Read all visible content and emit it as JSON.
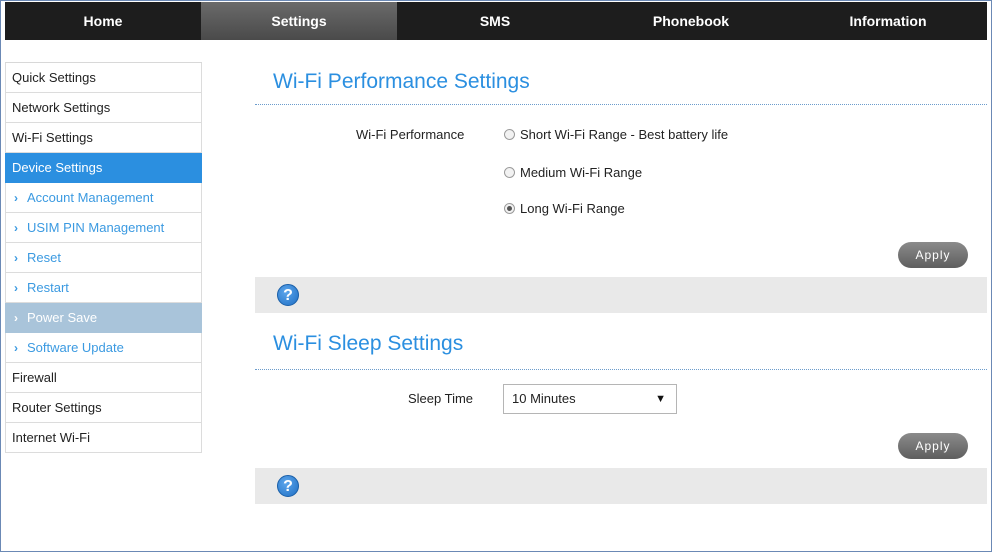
{
  "nav": {
    "tabs": [
      {
        "label": "Home"
      },
      {
        "label": "Settings"
      },
      {
        "label": "SMS"
      },
      {
        "label": "Phonebook"
      },
      {
        "label": "Information"
      }
    ],
    "active": "Settings"
  },
  "sidebar": {
    "items": [
      {
        "label": "Quick Settings"
      },
      {
        "label": "Network Settings"
      },
      {
        "label": "Wi-Fi Settings"
      },
      {
        "label": "Device Settings"
      },
      {
        "label": "Account Management"
      },
      {
        "label": "USIM PIN Management"
      },
      {
        "label": "Reset"
      },
      {
        "label": "Restart"
      },
      {
        "label": "Power Save"
      },
      {
        "label": "Software Update"
      },
      {
        "label": "Firewall"
      },
      {
        "label": "Router Settings"
      },
      {
        "label": "Internet Wi-Fi"
      }
    ],
    "active_item": "Device Settings",
    "selected_sub_item": "Power Save"
  },
  "performance": {
    "title": "Wi-Fi Performance Settings",
    "field_label": "Wi-Fi Performance",
    "options": [
      {
        "label": "Short Wi-Fi Range - Best battery life",
        "checked": false
      },
      {
        "label": "Medium Wi-Fi Range",
        "checked": false
      },
      {
        "label": "Long Wi-Fi Range",
        "checked": true
      }
    ],
    "apply_label": "Apply",
    "help_glyph": "?"
  },
  "sleep": {
    "title": "Wi-Fi Sleep Settings",
    "field_label": "Sleep Time",
    "selected_value": "10 Minutes",
    "caret": "▼",
    "apply_label": "Apply",
    "help_glyph": "?"
  },
  "icons": {
    "sub_arrow": "›",
    "help": "help-icon"
  },
  "colors": {
    "accent": "#2b8fe0",
    "nav_bg": "#1d1d1d",
    "nav_active": "#5a5a5a",
    "selected_sub_bg": "#a9c4da",
    "help_bar": "#e9e9e9"
  }
}
